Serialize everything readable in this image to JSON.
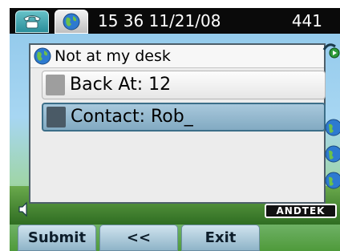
{
  "status_bar": {
    "datetime": "15 36 11/21/08",
    "extension": "441",
    "tabs": [
      {
        "icon": "phone-icon"
      },
      {
        "icon": "globe-icon"
      }
    ]
  },
  "dialog": {
    "title": "Not at my desk",
    "title_icon": "globe-icon",
    "fields": {
      "back_at": "Back At: 12",
      "contact": "Contact: Rob_"
    }
  },
  "softkeys": {
    "submit": "Submit",
    "back": "<<",
    "exit": "Exit"
  },
  "branding": {
    "logo_text": "ANDTEK"
  },
  "colors": {
    "status_bar": "#0a0a0a",
    "selected_field": "#94b8ce",
    "softkey": "#a9c8d8"
  }
}
